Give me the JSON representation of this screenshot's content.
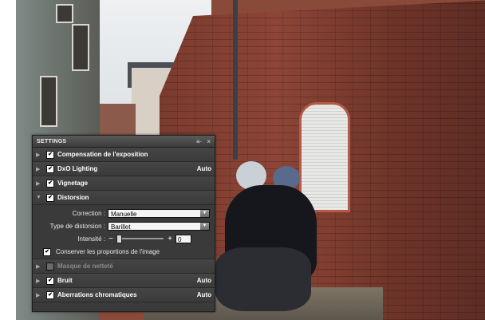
{
  "panel": {
    "title": "SETTINGS",
    "menu_glyph": "≡·",
    "close_glyph": "×"
  },
  "sections": [
    {
      "label": "Compensation de l'exposition",
      "checked": true,
      "enabled": true,
      "value": "",
      "expanded": false
    },
    {
      "label": "DxO Lighting",
      "checked": true,
      "enabled": true,
      "value": "Auto",
      "expanded": false
    },
    {
      "label": "Vignetage",
      "checked": true,
      "enabled": true,
      "value": "",
      "expanded": false
    },
    {
      "label": "Distorsion",
      "checked": true,
      "enabled": true,
      "value": "",
      "expanded": true
    },
    {
      "label": "Masque de netteté",
      "checked": false,
      "enabled": false,
      "value": "",
      "expanded": false
    },
    {
      "label": "Bruit",
      "checked": true,
      "enabled": true,
      "value": "Auto",
      "expanded": false
    },
    {
      "label": "Aberrations chromatiques",
      "checked": true,
      "enabled": true,
      "value": "Auto",
      "expanded": false
    }
  ],
  "distorsion": {
    "correction_label": "Correction :",
    "correction_value": "Manuelle",
    "type_label": "Type de distorsion :",
    "type_value": "Barillet",
    "intensity_label": "Intensité :",
    "intensity_value": "0",
    "minus": "−",
    "plus": "+",
    "keep_label": "Conserver les proportions de l'image",
    "keep_checked": true
  }
}
